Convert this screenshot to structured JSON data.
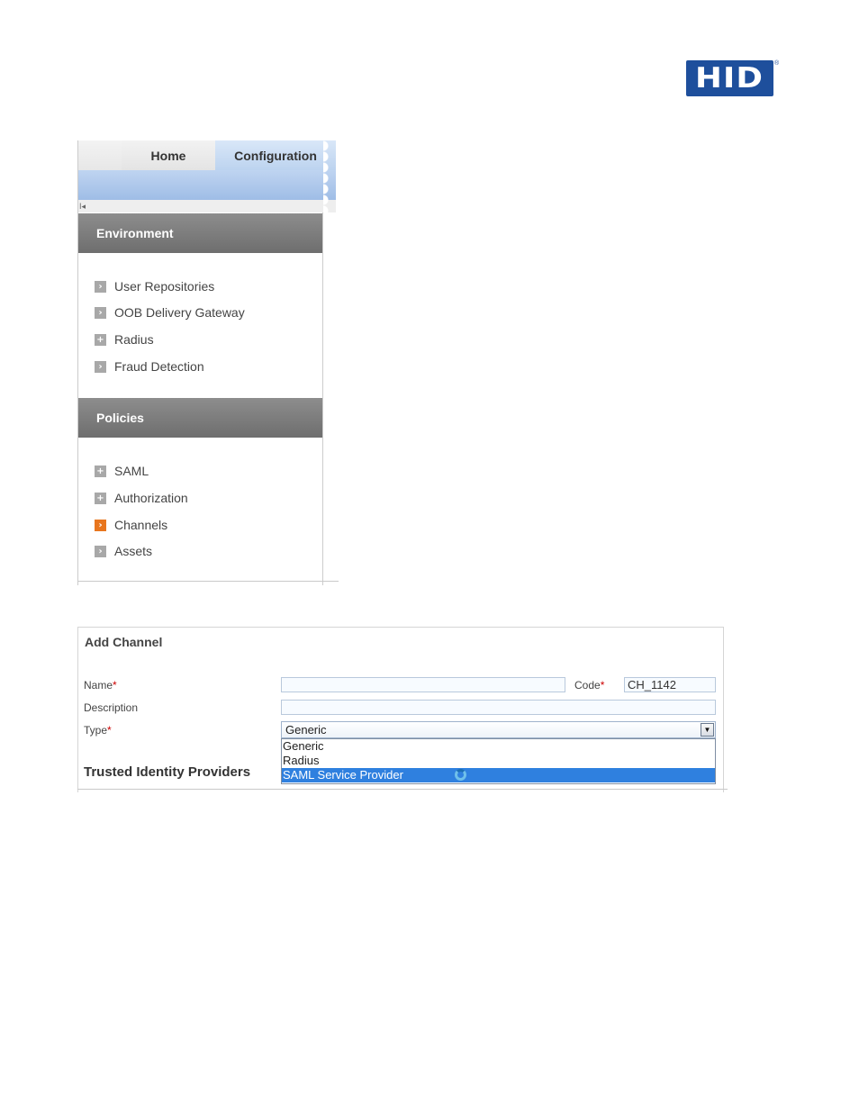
{
  "logo": {
    "text": "HID",
    "reg_mark": "®",
    "color": "#1e4f9c"
  },
  "nav": {
    "tabs": [
      {
        "label": "Home"
      },
      {
        "label": "Configuration"
      }
    ],
    "collapse_glyph": "I◂",
    "sections": [
      {
        "title": "Environment",
        "items": [
          {
            "label": "User Repositories",
            "icon": "arrow-right-icon"
          },
          {
            "label": "OOB Delivery Gateway",
            "icon": "arrow-right-icon"
          },
          {
            "label": "Radius",
            "icon": "plus-icon"
          },
          {
            "label": "Fraud Detection",
            "icon": "arrow-right-icon"
          }
        ]
      },
      {
        "title": "Policies",
        "items": [
          {
            "label": "SAML",
            "icon": "plus-icon"
          },
          {
            "label": "Authorization",
            "icon": "plus-icon"
          },
          {
            "label": "Channels",
            "icon": "arrow-right-icon",
            "active": true
          },
          {
            "label": "Assets",
            "icon": "arrow-right-icon"
          }
        ]
      }
    ],
    "icon_glyphs": {
      "arrow": "›",
      "plus": "+"
    },
    "active_color": "#e8761e"
  },
  "form": {
    "title": "Add Channel",
    "name_label": "Name",
    "name_value": "",
    "code_label": "Code",
    "code_value": "CH_1142",
    "required_mark": "*",
    "description_label": "Description",
    "description_value": "",
    "type_label": "Type",
    "type_value": "Generic",
    "type_options": [
      "Generic",
      "Radius",
      "SAML Service Provider"
    ],
    "selected_highlight_color": "#2f80df",
    "section_heading": "Trusted Identity Providers"
  }
}
